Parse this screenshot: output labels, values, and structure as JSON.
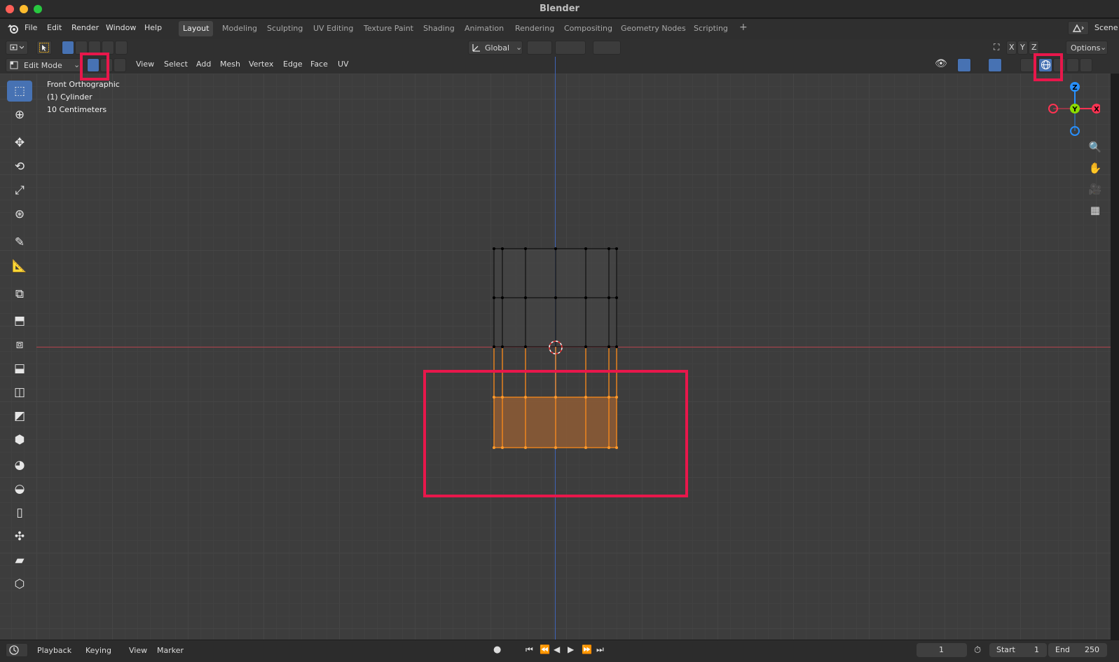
{
  "app": {
    "title": "Blender"
  },
  "menu": [
    "File",
    "Edit",
    "Render",
    "Window",
    "Help"
  ],
  "workspaces": [
    {
      "label": "Layout",
      "active": true
    },
    {
      "label": "Modeling"
    },
    {
      "label": "Sculpting"
    },
    {
      "label": "UV Editing"
    },
    {
      "label": "Texture Paint"
    },
    {
      "label": "Shading"
    },
    {
      "label": "Animation"
    },
    {
      "label": "Rendering"
    },
    {
      "label": "Compositing"
    },
    {
      "label": "Geometry Nodes"
    },
    {
      "label": "Scripting"
    }
  ],
  "scene_label": "Scene",
  "tool_header": {
    "orientation": "Global",
    "axes": [
      "X",
      "Y",
      "Z"
    ],
    "options": "Options"
  },
  "view_header": {
    "mode": "Edit Mode",
    "menus": [
      "View",
      "Select",
      "Add",
      "Mesh",
      "Vertex",
      "Edge",
      "Face",
      "UV"
    ]
  },
  "viewport": {
    "view_name": "Front Orthographic",
    "object_name": "(1) Cylinder",
    "scale": "10 Centimeters",
    "gizmo": {
      "z": "Z",
      "y": "Y",
      "x": "X"
    }
  },
  "timeline": {
    "menus": [
      "Playback",
      "Keying",
      "View",
      "Marker"
    ],
    "current_frame": "1",
    "start_label": "Start",
    "start": "1",
    "end_label": "End",
    "end": "250"
  },
  "colors": {
    "selection_highlight": "#e8174b",
    "accent": "#4772b3",
    "selected_mesh": "#ff8c1a",
    "x_axis": "#ff3352",
    "y_axis": "#8bdc00",
    "z_axis": "#2890ff"
  },
  "icons": {
    "blender_logo": "blender-logo-icon",
    "select_box": "select-box-icon",
    "cursor": "cursor-icon",
    "move": "move-icon",
    "rotate": "rotate-icon",
    "scale": "scale-icon",
    "transform": "transform-icon",
    "annotate": "annotate-icon",
    "measure": "measure-icon",
    "add_cube": "add-cube-icon",
    "extrude": "extrude-icon",
    "inset": "inset-icon",
    "bevel": "bevel-icon",
    "loop_cut": "loop-cut-icon",
    "knife": "knife-icon",
    "poly_build": "poly-build-icon",
    "spin": "spin-icon",
    "smooth": "smooth-icon",
    "edge_slide": "edge-slide-icon",
    "shrink_fatten": "shrink-fatten-icon",
    "shear": "shear-icon",
    "rip": "rip-icon"
  }
}
